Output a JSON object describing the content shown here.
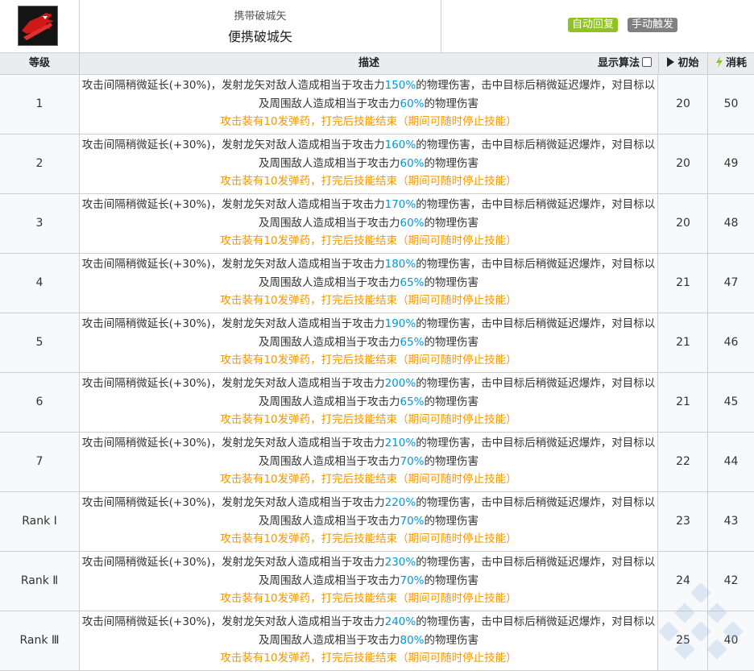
{
  "skill": {
    "icon": "dragon-arrow-skill-icon",
    "subtitle": "携带破城矢",
    "name": "便携破城矢",
    "tags": [
      "自动回复",
      "手动触发"
    ]
  },
  "table": {
    "headers": {
      "level": "等级",
      "description": "描述",
      "show_formula": "显示算法",
      "initial": "初始",
      "cost": "消耗"
    },
    "rows": [
      {
        "level": "1",
        "desc_pre": "攻击间隔稍微延长(+30%)，发射龙矢对敌人造成相当于攻击力",
        "pct1": "150%",
        "desc_mid": "的物理伤害，击中目标后稍微延迟爆炸，对目标以及周围敌人造成相当于攻击力",
        "pct2": "60%",
        "desc_post": "的物理伤害",
        "note": "攻击装有10发弹药，打完后技能结束（期间可随时停止技能）",
        "initial": "20",
        "cost": "50"
      },
      {
        "level": "2",
        "desc_pre": "攻击间隔稍微延长(+30%)，发射龙矢对敌人造成相当于攻击力",
        "pct1": "160%",
        "desc_mid": "的物理伤害，击中目标后稍微延迟爆炸，对目标以及周围敌人造成相当于攻击力",
        "pct2": "60%",
        "desc_post": "的物理伤害",
        "note": "攻击装有10发弹药，打完后技能结束（期间可随时停止技能）",
        "initial": "20",
        "cost": "49"
      },
      {
        "level": "3",
        "desc_pre": "攻击间隔稍微延长(+30%)，发射龙矢对敌人造成相当于攻击力",
        "pct1": "170%",
        "desc_mid": "的物理伤害，击中目标后稍微延迟爆炸，对目标以及周围敌人造成相当于攻击力",
        "pct2": "60%",
        "desc_post": "的物理伤害",
        "note": "攻击装有10发弹药，打完后技能结束（期间可随时停止技能）",
        "initial": "20",
        "cost": "48"
      },
      {
        "level": "4",
        "desc_pre": "攻击间隔稍微延长(+30%)，发射龙矢对敌人造成相当于攻击力",
        "pct1": "180%",
        "desc_mid": "的物理伤害，击中目标后稍微延迟爆炸，对目标以及周围敌人造成相当于攻击力",
        "pct2": "65%",
        "desc_post": "的物理伤害",
        "note": "攻击装有10发弹药，打完后技能结束（期间可随时停止技能）",
        "initial": "21",
        "cost": "47"
      },
      {
        "level": "5",
        "desc_pre": "攻击间隔稍微延长(+30%)，发射龙矢对敌人造成相当于攻击力",
        "pct1": "190%",
        "desc_mid": "的物理伤害，击中目标后稍微延迟爆炸，对目标以及周围敌人造成相当于攻击力",
        "pct2": "65%",
        "desc_post": "的物理伤害",
        "note": "攻击装有10发弹药，打完后技能结束（期间可随时停止技能）",
        "initial": "21",
        "cost": "46"
      },
      {
        "level": "6",
        "desc_pre": "攻击间隔稍微延长(+30%)，发射龙矢对敌人造成相当于攻击力",
        "pct1": "200%",
        "desc_mid": "的物理伤害，击中目标后稍微延迟爆炸，对目标以及周围敌人造成相当于攻击力",
        "pct2": "65%",
        "desc_post": "的物理伤害",
        "note": "攻击装有10发弹药，打完后技能结束（期间可随时停止技能）",
        "initial": "21",
        "cost": "45"
      },
      {
        "level": "7",
        "desc_pre": "攻击间隔稍微延长(+30%)，发射龙矢对敌人造成相当于攻击力",
        "pct1": "210%",
        "desc_mid": "的物理伤害，击中目标后稍微延迟爆炸，对目标以及周围敌人造成相当于攻击力",
        "pct2": "70%",
        "desc_post": "的物理伤害",
        "note": "攻击装有10发弹药，打完后技能结束（期间可随时停止技能）",
        "initial": "22",
        "cost": "44"
      },
      {
        "level": "Rank Ⅰ",
        "desc_pre": "攻击间隔稍微延长(+30%)，发射龙矢对敌人造成相当于攻击力",
        "pct1": "220%",
        "desc_mid": "的物理伤害，击中目标后稍微延迟爆炸，对目标以及周围敌人造成相当于攻击力",
        "pct2": "70%",
        "desc_post": "的物理伤害",
        "note": "攻击装有10发弹药，打完后技能结束（期间可随时停止技能）",
        "initial": "23",
        "cost": "43"
      },
      {
        "level": "Rank Ⅱ",
        "desc_pre": "攻击间隔稍微延长(+30%)，发射龙矢对敌人造成相当于攻击力",
        "pct1": "230%",
        "desc_mid": "的物理伤害，击中目标后稍微延迟爆炸，对目标以及周围敌人造成相当于攻击力",
        "pct2": "70%",
        "desc_post": "的物理伤害",
        "note": "攻击装有10发弹药，打完后技能结束（期间可随时停止技能）",
        "initial": "24",
        "cost": "42"
      },
      {
        "level": "Rank Ⅲ",
        "desc_pre": "攻击间隔稍微延长(+30%)，发射龙矢对敌人造成相当于攻击力",
        "pct1": "240%",
        "desc_mid": "的物理伤害，击中目标后稍微延迟爆炸，对目标以及周围敌人造成相当于攻击力",
        "pct2": "80%",
        "desc_post": "的物理伤害",
        "note": "攻击装有10发弹药，打完后技能结束（期间可随时停止技能）",
        "initial": "25",
        "cost": "40"
      }
    ]
  },
  "colors": {
    "highlight": "#0098dc",
    "note": "#f49800",
    "tag_auto": "#8fc31f",
    "tag_manual": "#808080"
  }
}
